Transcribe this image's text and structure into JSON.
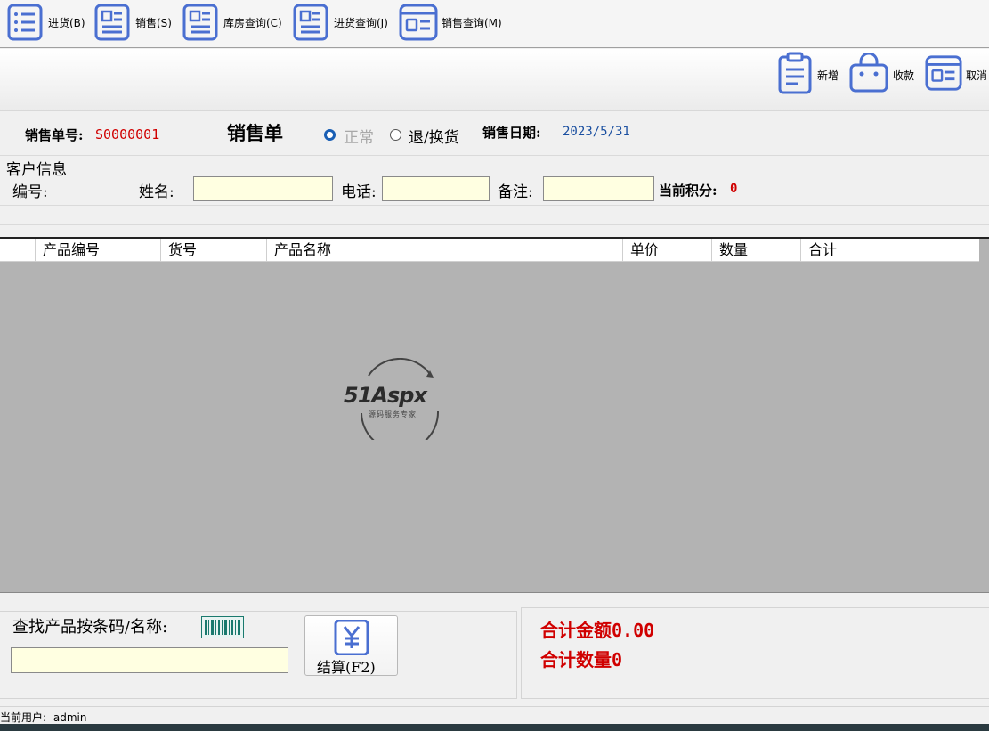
{
  "toolbar": {
    "items": [
      {
        "label": "进货(B)",
        "icon": "list-icon"
      },
      {
        "label": "销售(S)",
        "icon": "document-icon"
      },
      {
        "label": "库房查询(C)",
        "icon": "document-icon"
      },
      {
        "label": "进货查询(J)",
        "icon": "document-icon"
      },
      {
        "label": "销售查询(M)",
        "icon": "card-icon"
      }
    ]
  },
  "actions": {
    "new_label": "新增",
    "pay_label": "收款",
    "cancel_label": "取消"
  },
  "order": {
    "number_label": "销售单号:",
    "number_value": "S0000001",
    "title": "销售单",
    "mode_normal": "正常",
    "mode_return": "退/换货",
    "date_label": "销售日期:",
    "date_value": "2023/5/31"
  },
  "customer": {
    "section_title": "客户信息",
    "id_label": "编号:",
    "name_label": "姓名:",
    "name_value": "",
    "phone_label": "电话:",
    "phone_value": "",
    "note_label": "备注:",
    "note_value": "",
    "points_label": "当前积分:",
    "points_value": "0"
  },
  "grid": {
    "columns": [
      "产品编号",
      "货号",
      "产品名称",
      "单价",
      "数量",
      "合计"
    ]
  },
  "watermark": {
    "brand": "51Aspx",
    "tagline": "源码服务专家"
  },
  "search": {
    "label": "查找产品按条码/名称:",
    "value": ""
  },
  "checkout": {
    "label": "结算(F2)"
  },
  "totals": {
    "amount_label": "合计金额",
    "amount_value": "0.00",
    "qty_label": "合计数量",
    "qty_value": "0"
  },
  "status": {
    "user_label": "当前用户:",
    "user_value": "admin"
  },
  "colors": {
    "accent": "#4a6fd1",
    "red": "#d00000",
    "input_bg": "#ffffe1"
  }
}
